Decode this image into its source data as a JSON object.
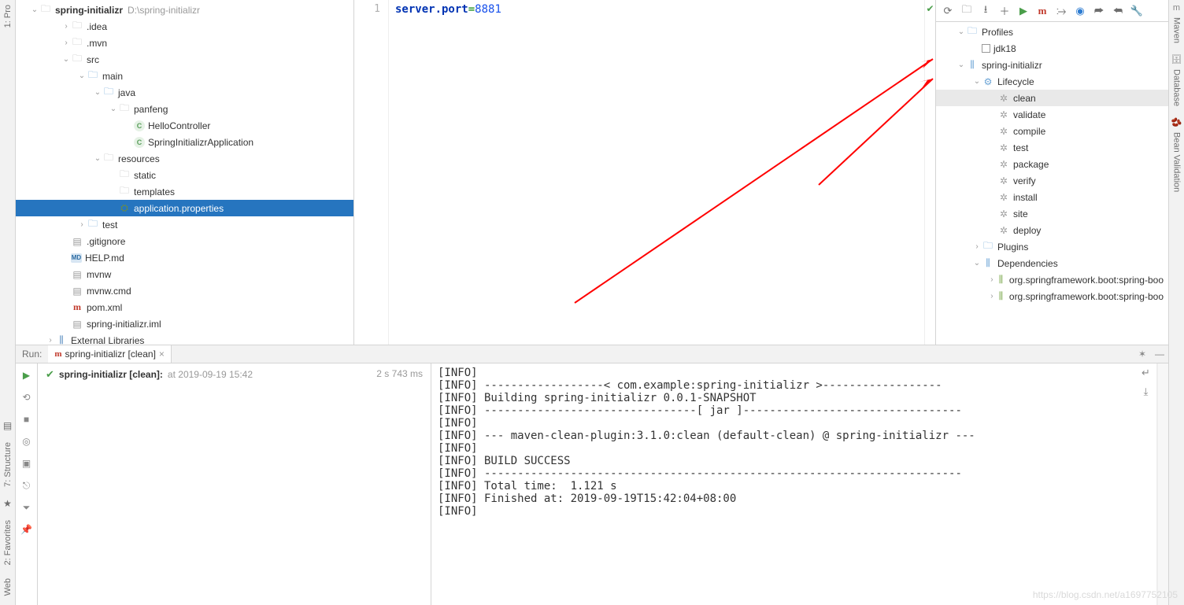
{
  "project": {
    "root": {
      "name": "spring-initializr",
      "path": "D:\\spring-initializr"
    },
    "tree": [
      {
        "label": ".idea",
        "indent": 1,
        "arrow": "right",
        "icon": "folder"
      },
      {
        "label": ".mvn",
        "indent": 1,
        "arrow": "right",
        "icon": "folder"
      },
      {
        "label": "src",
        "indent": 1,
        "arrow": "down",
        "icon": "folder"
      },
      {
        "label": "main",
        "indent": 2,
        "arrow": "down",
        "icon": "folder-blue"
      },
      {
        "label": "java",
        "indent": 3,
        "arrow": "down",
        "icon": "folder-blue"
      },
      {
        "label": "panfeng",
        "indent": 4,
        "arrow": "down",
        "icon": "folder"
      },
      {
        "label": "HelloController",
        "indent": 5,
        "arrow": "",
        "icon": "java"
      },
      {
        "label": "SpringInitializrApplication",
        "indent": 5,
        "arrow": "",
        "icon": "java"
      },
      {
        "label": "resources",
        "indent": 3,
        "arrow": "down",
        "icon": "folder"
      },
      {
        "label": "static",
        "indent": 4,
        "arrow": "",
        "icon": "folder"
      },
      {
        "label": "templates",
        "indent": 4,
        "arrow": "",
        "icon": "folder"
      },
      {
        "label": "application.properties",
        "indent": 4,
        "arrow": "",
        "icon": "prop",
        "selected": true
      },
      {
        "label": "test",
        "indent": 2,
        "arrow": "right",
        "icon": "folder-blue"
      },
      {
        "label": ".gitignore",
        "indent": 1,
        "arrow": "",
        "icon": "file"
      },
      {
        "label": "HELP.md",
        "indent": 1,
        "arrow": "",
        "icon": "md"
      },
      {
        "label": "mvnw",
        "indent": 1,
        "arrow": "",
        "icon": "file"
      },
      {
        "label": "mvnw.cmd",
        "indent": 1,
        "arrow": "",
        "icon": "file"
      },
      {
        "label": "pom.xml",
        "indent": 1,
        "arrow": "",
        "icon": "pom"
      },
      {
        "label": "spring-initializr.iml",
        "indent": 1,
        "arrow": "",
        "icon": "file"
      },
      {
        "label": "External Libraries",
        "indent": 0,
        "arrow": "right",
        "icon": "lib"
      }
    ]
  },
  "editor": {
    "line_no": "1",
    "code_key": "server.port",
    "code_op": "=",
    "code_val": "8881"
  },
  "maven": {
    "toolbar_icons": [
      "reload",
      "folders",
      "download",
      "add",
      "run",
      "m",
      "skip",
      "globe",
      "expand",
      "collapse",
      "settings"
    ],
    "tree": [
      {
        "label": "Profiles",
        "indent": 0,
        "arrow": "down",
        "icon": "profiles"
      },
      {
        "label": "jdk18",
        "indent": 1,
        "arrow": "",
        "icon": "checkbox"
      },
      {
        "label": "spring-initializr",
        "indent": 0,
        "arrow": "down",
        "icon": "module"
      },
      {
        "label": "Lifecycle",
        "indent": 1,
        "arrow": "down",
        "icon": "lifecycle"
      },
      {
        "label": "clean",
        "indent": 2,
        "arrow": "",
        "icon": "gear",
        "hilite": true
      },
      {
        "label": "validate",
        "indent": 2,
        "arrow": "",
        "icon": "gear"
      },
      {
        "label": "compile",
        "indent": 2,
        "arrow": "",
        "icon": "gear"
      },
      {
        "label": "test",
        "indent": 2,
        "arrow": "",
        "icon": "gear"
      },
      {
        "label": "package",
        "indent": 2,
        "arrow": "",
        "icon": "gear"
      },
      {
        "label": "verify",
        "indent": 2,
        "arrow": "",
        "icon": "gear"
      },
      {
        "label": "install",
        "indent": 2,
        "arrow": "",
        "icon": "gear"
      },
      {
        "label": "site",
        "indent": 2,
        "arrow": "",
        "icon": "gear"
      },
      {
        "label": "deploy",
        "indent": 2,
        "arrow": "",
        "icon": "gear"
      },
      {
        "label": "Plugins",
        "indent": 1,
        "arrow": "right",
        "icon": "plugins"
      },
      {
        "label": "Dependencies",
        "indent": 1,
        "arrow": "down",
        "icon": "deps"
      },
      {
        "label": "org.springframework.boot:spring-boo",
        "indent": 2,
        "arrow": "right",
        "icon": "dep"
      },
      {
        "label": "org.springframework.boot:spring-boo",
        "indent": 2,
        "arrow": "right",
        "icon": "dep"
      }
    ]
  },
  "run": {
    "tool_label": "Run:",
    "tab_label": "spring-initializr [clean]",
    "status_task": "spring-initializr [clean]:",
    "status_time": "at 2019-09-19 15:42",
    "status_duration": "2 s 743 ms",
    "console": "[INFO]\n[INFO] ------------------< com.example:spring-initializr >------------------\n[INFO] Building spring-initializr 0.0.1-SNAPSHOT\n[INFO] --------------------------------[ jar ]---------------------------------\n[INFO]\n[INFO] --- maven-clean-plugin:3.1.0:clean (default-clean) @ spring-initializr ---\n[INFO]\n[INFO] BUILD SUCCESS\n[INFO] ------------------------------------------------------------------------\n[INFO] Total time:  1.121 s\n[INFO] Finished at: 2019-09-19T15:42:04+08:00\n[INFO] "
  },
  "left_tabs": [
    "1: Pro",
    "",
    "7: Structure",
    "2: Favorites",
    "Web"
  ],
  "right_tabs": [
    "Maven",
    "Database",
    "Bean Validation"
  ],
  "watermark": "https://blog.csdn.net/a1697752105"
}
